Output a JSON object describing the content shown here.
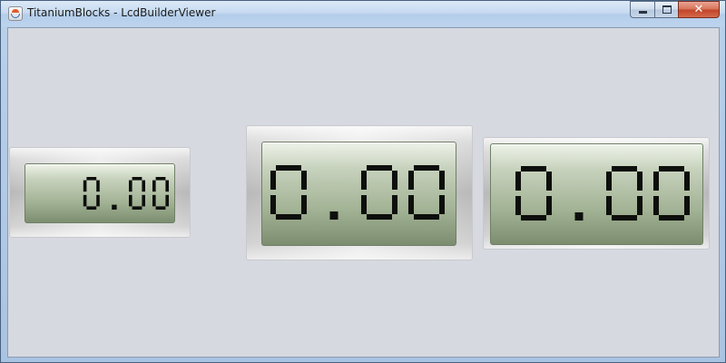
{
  "window": {
    "title": "TitaniumBlocks - LcdBuilderViewer",
    "app_icon": "java-cup-icon",
    "controls": {
      "minimize": "minimize-icon",
      "maximize": "maximize-icon",
      "close": "close-icon"
    }
  },
  "lcds": [
    {
      "id": "lcd-small",
      "value": "0.00"
    },
    {
      "id": "lcd-medium",
      "value": "0.00"
    },
    {
      "id": "lcd-large",
      "value": "0.00"
    }
  ],
  "colors": {
    "segment": "#0d0f0c",
    "lcd_top": "#eef3e9",
    "lcd_bottom": "#7d8d70",
    "content_bg": "#d6d9e0"
  }
}
